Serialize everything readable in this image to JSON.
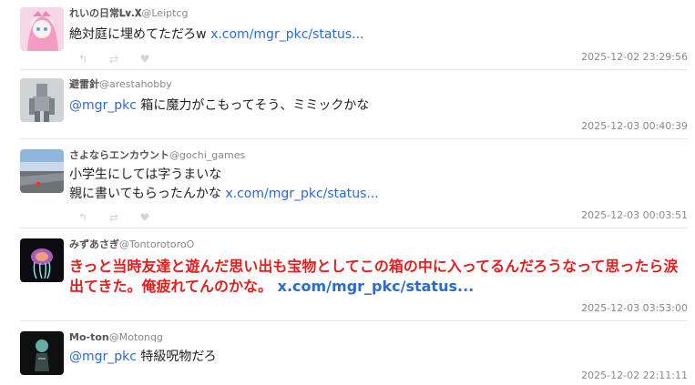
{
  "tweets": [
    {
      "name": "れいの日常𝐋𝐯.𝐗",
      "handle": "@Leiptcg",
      "text_before": "絶対庭に埋めてただろw ",
      "link": "x.com/mgr_pkc/status...",
      "timestamp": "2025-12-02 23:29:56",
      "avatar_icon": "anime-girl-avatar"
    },
    {
      "name": "避雷針",
      "handle": "@arestahobby",
      "mention": "@mgr_pkc",
      "text_after": " 箱に魔力がこもってそう、ミミックかな",
      "timestamp": "2025-12-03 00:40:39",
      "avatar_icon": "robot-model-avatar"
    },
    {
      "name": "さよならエンカウント",
      "handle": "@gochi_games",
      "line1": "小学生にしては字うまいな",
      "line2_before": "親に書いてもらったんかな ",
      "link": "x.com/mgr_pkc/status...",
      "timestamp": "2025-12-03 00:03:51",
      "avatar_icon": "sky-landscape-avatar"
    },
    {
      "name": "みずあさぎ",
      "handle": "@TontorotoroO",
      "text_before": "きっと当時友達と遊んだ思い出も宝物としてこの箱の中に入ってるんだろうなって思ったら涙出てきた。俺疲れてんのかな。 ",
      "link": "x.com/mgr_pkc/status...",
      "timestamp": "2025-12-03 03:53:00",
      "avatar_icon": "jellyfish-avatar"
    },
    {
      "name": "Mo-ton",
      "handle": "@Motonqg",
      "mention": "@mgr_pkc",
      "text_after": " 特級呪物だろ",
      "timestamp": "2025-12-02 22:11:11",
      "avatar_icon": "dark-figure-avatar"
    }
  ],
  "actions": {
    "reply_icon": "reply-icon",
    "retweet_icon": "retweet-icon",
    "like_icon": "heart-icon"
  },
  "colors": {
    "link": "#2a6bd1",
    "highlight": "#e0201d",
    "timestamp": "#8a8a8a",
    "icon_gray": "#d4d4d4"
  }
}
